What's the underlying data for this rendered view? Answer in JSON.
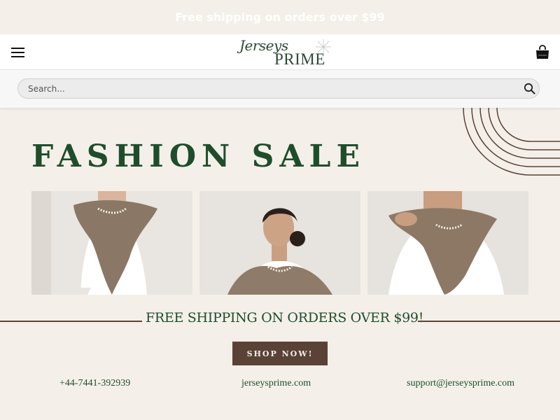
{
  "promo": {
    "text": "Free shipping on orders over $99"
  },
  "header": {
    "menu_icon": "hamburger-menu-icon",
    "logo": {
      "script": "Jerseys",
      "brand": "PRIME"
    },
    "cart_icon": "shopping-bag-icon"
  },
  "search": {
    "placeholder": "Search...",
    "icon": "search-icon"
  },
  "hero": {
    "title": "FASHION SALE",
    "images": [
      {
        "alt": "Model wearing knit scarf and pearl necklace"
      },
      {
        "alt": "Model looking down wearing knit scarf"
      },
      {
        "alt": "Model adjusting knit scarf"
      }
    ]
  },
  "banner": {
    "text": "FREE SHIPPING ON ORDERS OVER $99!"
  },
  "cta": {
    "label": "SHOP NOW!"
  },
  "contact": {
    "phone": "+44-7441-392939",
    "website": "jerseysprime.com",
    "email": "support@jerseysprime.com"
  },
  "colors": {
    "background": "#f4f0e9",
    "brand_green": "#1f4d2c",
    "accent_brown": "#5a4236"
  }
}
